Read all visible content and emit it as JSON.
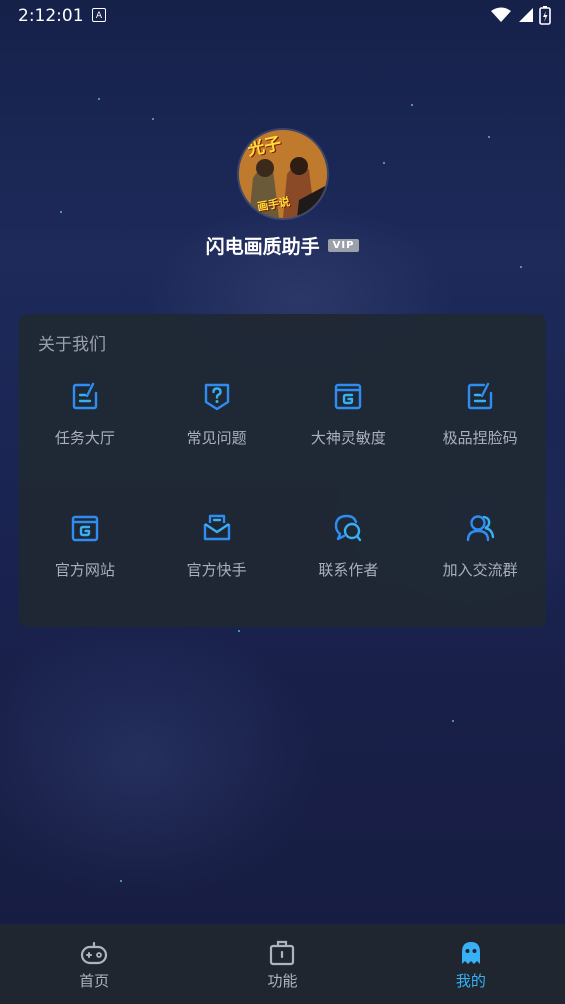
{
  "status_bar": {
    "time": "2:12:01",
    "notif_letter": "A"
  },
  "profile": {
    "avatar_text_top": "光子",
    "avatar_text_bottom": "画手说",
    "app_name": "闪电画质助手",
    "vip_badge": "VIP"
  },
  "about": {
    "title": "关于我们",
    "items": [
      {
        "label": "任务大厅",
        "icon": "edit-note-icon"
      },
      {
        "label": "常见问题",
        "icon": "question-shield-icon"
      },
      {
        "label": "大神灵敏度",
        "icon": "g-window-icon"
      },
      {
        "label": "极品捏脸码",
        "icon": "edit-note-icon"
      },
      {
        "label": "官方网站",
        "icon": "g-window-icon"
      },
      {
        "label": "官方快手",
        "icon": "envelope-icon"
      },
      {
        "label": "联系作者",
        "icon": "chat-bubble-icon"
      },
      {
        "label": "加入交流群",
        "icon": "group-users-icon"
      }
    ]
  },
  "tabbar": {
    "tabs": [
      {
        "label": "首页",
        "icon": "gamepad-icon",
        "active": false
      },
      {
        "label": "功能",
        "icon": "toolbox-icon",
        "active": false
      },
      {
        "label": "我的",
        "icon": "ghost-avatar-icon",
        "active": true
      }
    ]
  },
  "colors": {
    "accent": "#37b0f5",
    "icon_blue": "#2f8cf0",
    "card_bg": "#202834",
    "tabbar_bg": "#1f2630"
  }
}
